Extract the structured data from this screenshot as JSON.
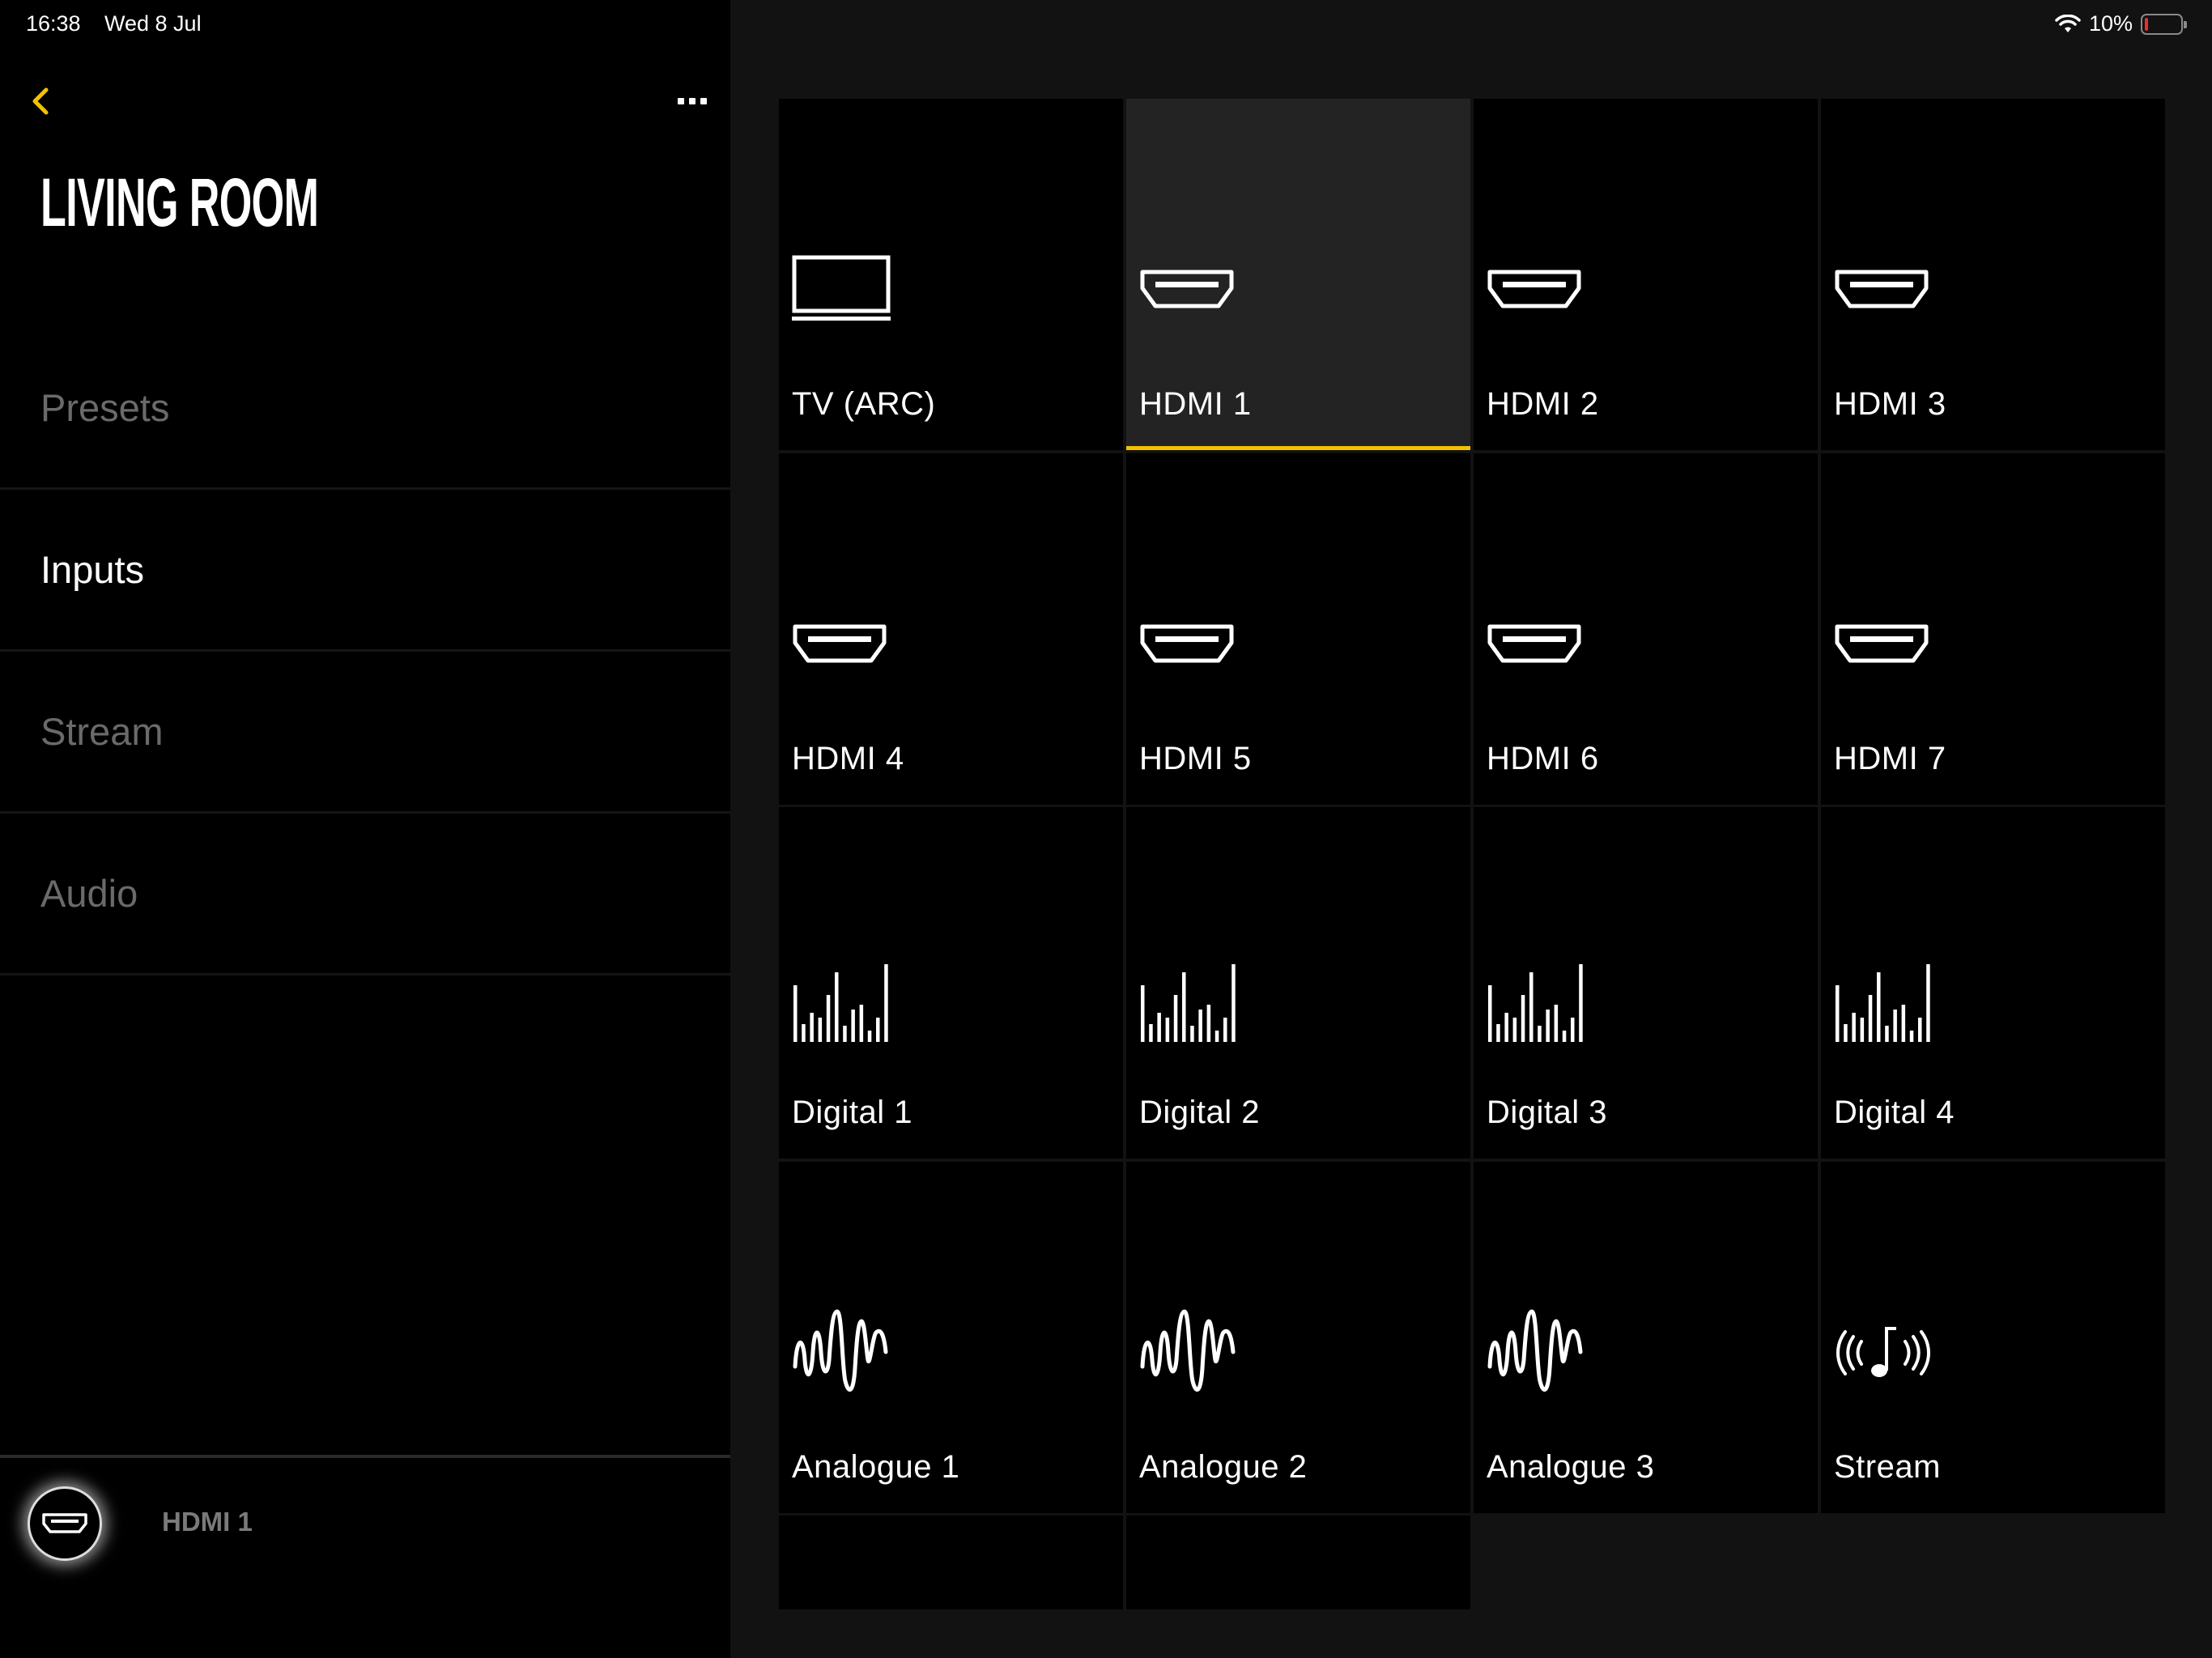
{
  "status_bar": {
    "time": "16:38",
    "date": "Wed 8 Jul",
    "battery": "10%"
  },
  "sidebar": {
    "title": "LIVING ROOM",
    "nav": [
      {
        "label": "Presets",
        "active": false
      },
      {
        "label": "Inputs",
        "active": true
      },
      {
        "label": "Stream",
        "active": false
      },
      {
        "label": "Audio",
        "active": false
      }
    ],
    "now_playing": {
      "label": "HDMI 1",
      "icon": "hdmi-icon"
    }
  },
  "colors": {
    "accent": "#f2c200",
    "selected_tile": "#232323",
    "tile": "#000000",
    "content_bg": "#121212"
  },
  "inputs": [
    {
      "label": "TV (ARC)",
      "icon": "tv-icon"
    },
    {
      "label": "HDMI 1",
      "icon": "hdmi-icon",
      "selected": true
    },
    {
      "label": "HDMI 2",
      "icon": "hdmi-icon"
    },
    {
      "label": "HDMI 3",
      "icon": "hdmi-icon"
    },
    {
      "label": "HDMI 4",
      "icon": "hdmi-icon"
    },
    {
      "label": "HDMI 5",
      "icon": "hdmi-icon"
    },
    {
      "label": "HDMI 6",
      "icon": "hdmi-icon"
    },
    {
      "label": "HDMI 7",
      "icon": "hdmi-icon"
    },
    {
      "label": "Digital 1",
      "icon": "digital-bars-icon"
    },
    {
      "label": "Digital 2",
      "icon": "digital-bars-icon"
    },
    {
      "label": "Digital 3",
      "icon": "digital-bars-icon"
    },
    {
      "label": "Digital 4",
      "icon": "digital-bars-icon"
    },
    {
      "label": "Analogue 1",
      "icon": "analogue-wave-icon"
    },
    {
      "label": "Analogue 2",
      "icon": "analogue-wave-icon"
    },
    {
      "label": "Analogue 3",
      "icon": "analogue-wave-icon"
    },
    {
      "label": "Stream",
      "icon": "stream-icon"
    }
  ]
}
